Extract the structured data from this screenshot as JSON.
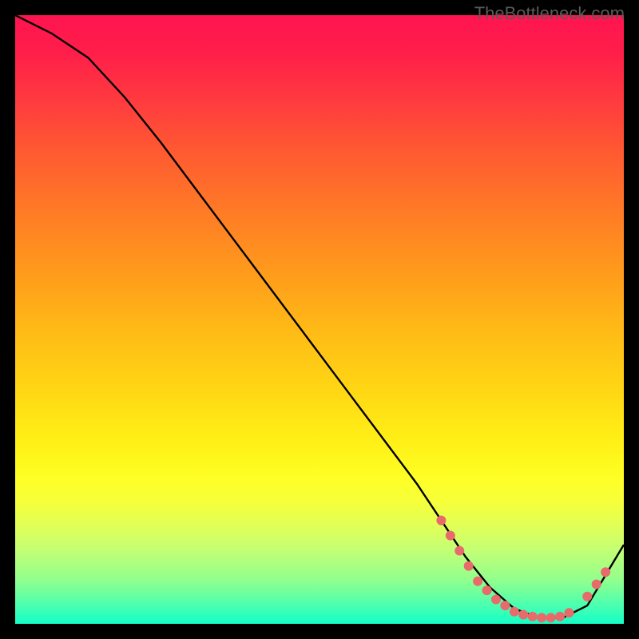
{
  "watermark": "TheBottleneck.com",
  "chart_data": {
    "type": "line",
    "title": "",
    "xlabel": "",
    "ylabel": "",
    "xlim": [
      0,
      100
    ],
    "ylim": [
      0,
      100
    ],
    "grid": false,
    "series": [
      {
        "name": "curve",
        "color": "#000000",
        "x": [
          0,
          6,
          12,
          18,
          24,
          30,
          36,
          42,
          48,
          54,
          60,
          66,
          70,
          74,
          78,
          82,
          86,
          90,
          94,
          100
        ],
        "y": [
          100,
          97,
          93,
          86.5,
          79,
          71,
          63,
          55,
          47,
          39,
          31,
          23,
          17,
          11,
          6,
          2.5,
          1,
          1,
          3,
          13
        ]
      }
    ],
    "markers": [
      {
        "x": 70.0,
        "y": 17.0
      },
      {
        "x": 71.5,
        "y": 14.5
      },
      {
        "x": 73.0,
        "y": 12.0
      },
      {
        "x": 74.5,
        "y": 9.5
      },
      {
        "x": 76.0,
        "y": 7.0
      },
      {
        "x": 77.5,
        "y": 5.5
      },
      {
        "x": 79.0,
        "y": 4.0
      },
      {
        "x": 80.5,
        "y": 3.0
      },
      {
        "x": 82.0,
        "y": 2.0
      },
      {
        "x": 83.5,
        "y": 1.5
      },
      {
        "x": 85.0,
        "y": 1.2
      },
      {
        "x": 86.5,
        "y": 1.0
      },
      {
        "x": 88.0,
        "y": 1.0
      },
      {
        "x": 89.5,
        "y": 1.2
      },
      {
        "x": 91.0,
        "y": 1.8
      },
      {
        "x": 94.0,
        "y": 4.5
      },
      {
        "x": 95.5,
        "y": 6.5
      },
      {
        "x": 97.0,
        "y": 8.5
      }
    ],
    "marker_color": "#e86a6a",
    "gradient_stops": [
      {
        "pos": 0,
        "color": "#ff1450"
      },
      {
        "pos": 50,
        "color": "#ffbb16"
      },
      {
        "pos": 76,
        "color": "#feff24"
      },
      {
        "pos": 100,
        "color": "#13ffc6"
      }
    ]
  }
}
